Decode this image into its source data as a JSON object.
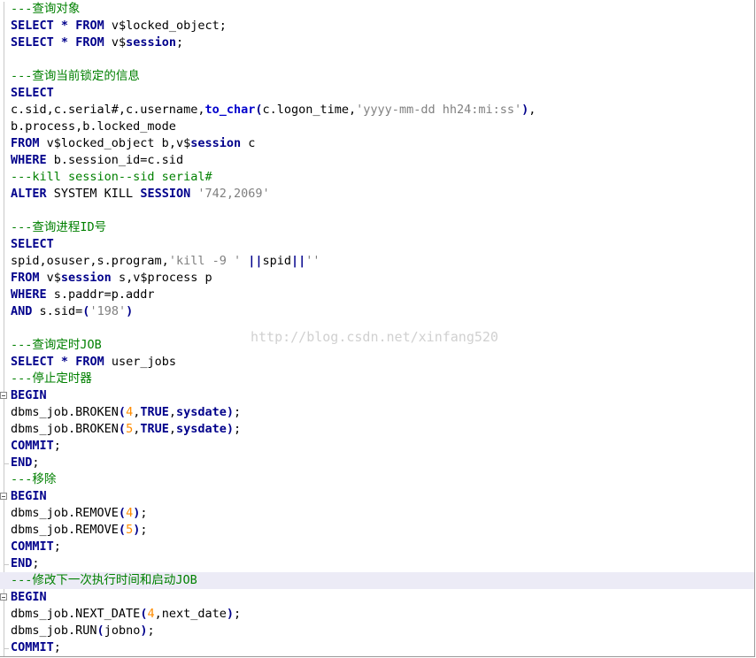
{
  "editor": {
    "watermark": "http://blog.csdn.net/xinfang520",
    "highlighted_line": 34,
    "lines": [
      [
        {
          "c": "cm",
          "v": "---查询对象"
        }
      ],
      [
        {
          "c": "kw",
          "v": "SELECT"
        },
        {
          "c": "",
          "v": " "
        },
        {
          "c": "op",
          "v": "*"
        },
        {
          "c": "",
          "v": " "
        },
        {
          "c": "kw",
          "v": "FROM"
        },
        {
          "c": "",
          "v": " v$locked_object;"
        }
      ],
      [
        {
          "c": "kw",
          "v": "SELECT"
        },
        {
          "c": "",
          "v": " "
        },
        {
          "c": "op",
          "v": "*"
        },
        {
          "c": "",
          "v": " "
        },
        {
          "c": "kw",
          "v": "FROM"
        },
        {
          "c": "",
          "v": " v$"
        },
        {
          "c": "kw",
          "v": "session"
        },
        {
          "c": "",
          "v": ";"
        }
      ],
      [
        {
          "c": "",
          "v": " "
        }
      ],
      [
        {
          "c": "cm",
          "v": "---查询当前锁定的信息"
        }
      ],
      [
        {
          "c": "kw",
          "v": "SELECT"
        }
      ],
      [
        {
          "c": "",
          "v": "c.sid,c.serial#,c.username,"
        },
        {
          "c": "fn",
          "v": "to_char"
        },
        {
          "c": "op",
          "v": "("
        },
        {
          "c": "",
          "v": "c.logon_time,"
        },
        {
          "c": "str",
          "v": "'yyyy-mm-dd hh24:mi:ss'"
        },
        {
          "c": "op",
          "v": ")"
        },
        {
          "c": "",
          "v": ","
        }
      ],
      [
        {
          "c": "",
          "v": "b.process,b.locked_mode"
        }
      ],
      [
        {
          "c": "kw",
          "v": "FROM"
        },
        {
          "c": "",
          "v": " v$locked_object b,v$"
        },
        {
          "c": "kw",
          "v": "session"
        },
        {
          "c": "",
          "v": " c"
        }
      ],
      [
        {
          "c": "kw",
          "v": "WHERE"
        },
        {
          "c": "",
          "v": " b.session_id=c.sid"
        }
      ],
      [
        {
          "c": "cm",
          "v": "---kill session--sid serial#"
        }
      ],
      [
        {
          "c": "kw",
          "v": "ALTER"
        },
        {
          "c": "",
          "v": " SYSTEM KILL "
        },
        {
          "c": "kw",
          "v": "SESSION"
        },
        {
          "c": "",
          "v": " "
        },
        {
          "c": "str",
          "v": "'742,2069'"
        }
      ],
      [
        {
          "c": "",
          "v": " "
        }
      ],
      [
        {
          "c": "cm",
          "v": "---查询进程ID号"
        }
      ],
      [
        {
          "c": "kw",
          "v": "SELECT"
        }
      ],
      [
        {
          "c": "",
          "v": "spid,osuser,s.program,"
        },
        {
          "c": "str",
          "v": "'kill -9 '"
        },
        {
          "c": "",
          "v": " "
        },
        {
          "c": "op",
          "v": "||"
        },
        {
          "c": "",
          "v": "spid"
        },
        {
          "c": "op",
          "v": "||"
        },
        {
          "c": "str",
          "v": "''"
        }
      ],
      [
        {
          "c": "kw",
          "v": "FROM"
        },
        {
          "c": "",
          "v": " v$"
        },
        {
          "c": "kw",
          "v": "session"
        },
        {
          "c": "",
          "v": " s,v$process p"
        }
      ],
      [
        {
          "c": "kw",
          "v": "WHERE"
        },
        {
          "c": "",
          "v": " s.paddr=p.addr"
        }
      ],
      [
        {
          "c": "kw",
          "v": "AND"
        },
        {
          "c": "",
          "v": " s.sid="
        },
        {
          "c": "op",
          "v": "("
        },
        {
          "c": "str",
          "v": "'198'"
        },
        {
          "c": "op",
          "v": ")"
        }
      ],
      [
        {
          "c": "",
          "v": " "
        }
      ],
      [
        {
          "c": "cm",
          "v": "---查询定时JOB"
        }
      ],
      [
        {
          "c": "kw",
          "v": "SELECT"
        },
        {
          "c": "",
          "v": " "
        },
        {
          "c": "op",
          "v": "*"
        },
        {
          "c": "",
          "v": " "
        },
        {
          "c": "kw",
          "v": "FROM"
        },
        {
          "c": "",
          "v": " user_jobs"
        }
      ],
      [
        {
          "c": "cm",
          "v": "---停止定时器"
        }
      ],
      [
        {
          "c": "kw",
          "v": "BEGIN"
        }
      ],
      [
        {
          "c": "",
          "v": "dbms_job.BROKEN"
        },
        {
          "c": "op",
          "v": "("
        },
        {
          "c": "num",
          "v": "4"
        },
        {
          "c": "",
          "v": ","
        },
        {
          "c": "kw",
          "v": "TRUE"
        },
        {
          "c": "",
          "v": ","
        },
        {
          "c": "kw",
          "v": "sysdate"
        },
        {
          "c": "op",
          "v": ")"
        },
        {
          "c": "",
          "v": ";"
        }
      ],
      [
        {
          "c": "",
          "v": "dbms_job.BROKEN"
        },
        {
          "c": "op",
          "v": "("
        },
        {
          "c": "num",
          "v": "5"
        },
        {
          "c": "",
          "v": ","
        },
        {
          "c": "kw",
          "v": "TRUE"
        },
        {
          "c": "",
          "v": ","
        },
        {
          "c": "kw",
          "v": "sysdate"
        },
        {
          "c": "op",
          "v": ")"
        },
        {
          "c": "",
          "v": ";"
        }
      ],
      [
        {
          "c": "kw",
          "v": "COMMIT"
        },
        {
          "c": "",
          "v": ";"
        }
      ],
      [
        {
          "c": "kw",
          "v": "END"
        },
        {
          "c": "",
          "v": ";"
        }
      ],
      [
        {
          "c": "cm",
          "v": "---移除"
        }
      ],
      [
        {
          "c": "kw",
          "v": "BEGIN"
        }
      ],
      [
        {
          "c": "",
          "v": "dbms_job.REMOVE"
        },
        {
          "c": "op",
          "v": "("
        },
        {
          "c": "num",
          "v": "4"
        },
        {
          "c": "op",
          "v": ")"
        },
        {
          "c": "",
          "v": ";"
        }
      ],
      [
        {
          "c": "",
          "v": "dbms_job.REMOVE"
        },
        {
          "c": "op",
          "v": "("
        },
        {
          "c": "num",
          "v": "5"
        },
        {
          "c": "op",
          "v": ")"
        },
        {
          "c": "",
          "v": ";"
        }
      ],
      [
        {
          "c": "kw",
          "v": "COMMIT"
        },
        {
          "c": "",
          "v": ";"
        }
      ],
      [
        {
          "c": "kw",
          "v": "END"
        },
        {
          "c": "",
          "v": ";"
        }
      ],
      [
        {
          "c": "cm",
          "v": "---修改下一次执行时间和启动JOB"
        }
      ],
      [
        {
          "c": "kw",
          "v": "BEGIN"
        }
      ],
      [
        {
          "c": "",
          "v": "dbms_job.NEXT_DATE"
        },
        {
          "c": "op",
          "v": "("
        },
        {
          "c": "num",
          "v": "4"
        },
        {
          "c": "",
          "v": ",next_date"
        },
        {
          "c": "op",
          "v": ")"
        },
        {
          "c": "",
          "v": ";"
        }
      ],
      [
        {
          "c": "",
          "v": "dbms_job.RUN"
        },
        {
          "c": "op",
          "v": "("
        },
        {
          "c": "",
          "v": "jobno"
        },
        {
          "c": "op",
          "v": ")"
        },
        {
          "c": "",
          "v": ";"
        }
      ],
      [
        {
          "c": "kw",
          "v": "COMMIT"
        },
        {
          "c": "",
          "v": ";"
        }
      ]
    ],
    "fold_starts": [
      23,
      29,
      35
    ],
    "fold_ends": [
      27,
      33,
      38
    ]
  },
  "colors": {
    "keyword": "#00008b",
    "comment": "#008000",
    "string": "#808080",
    "number": "#ff8c00",
    "function": "#0000cd",
    "highlight": "#ecebf6"
  }
}
